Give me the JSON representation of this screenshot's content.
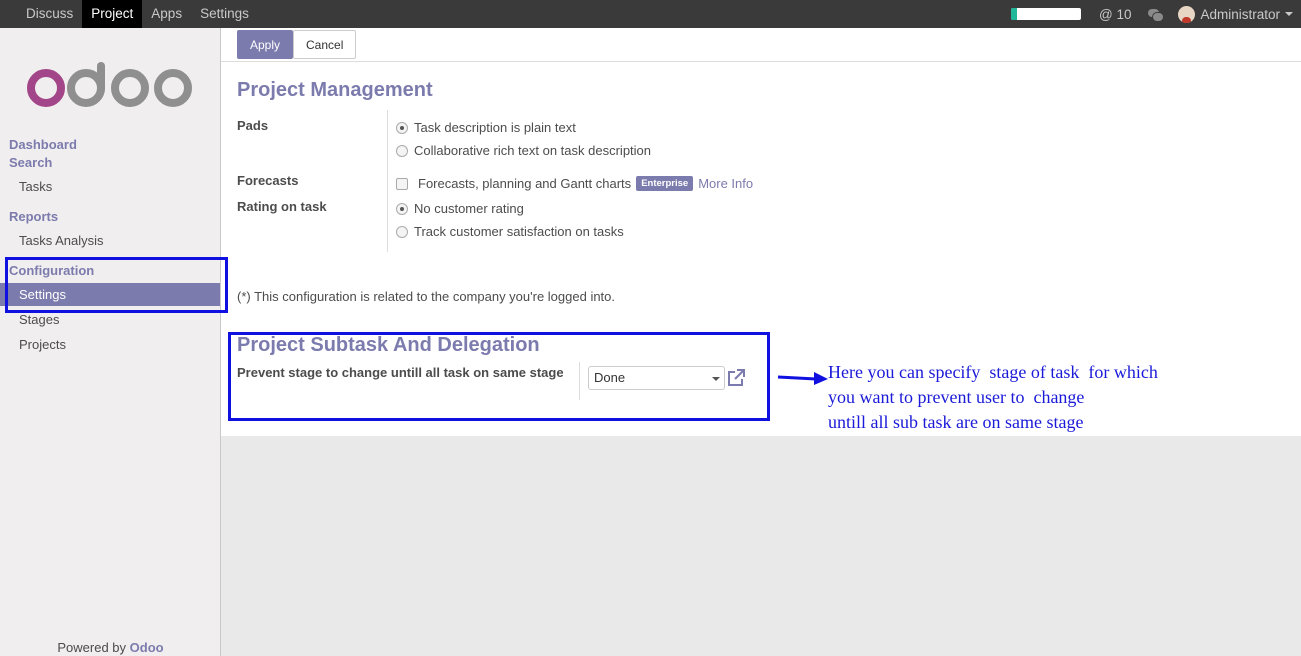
{
  "topbar": {
    "menu": [
      "Discuss",
      "Project",
      "Apps",
      "Settings"
    ],
    "active_menu": "Project",
    "progress_fraction": 0.08,
    "mentions": "@ 10",
    "user": "Administrator"
  },
  "sidebar": {
    "logo_text": "odoo",
    "sections": {
      "dashboard": "Dashboard",
      "search": "Search",
      "tasks": "Tasks",
      "reports": "Reports",
      "tasks_analysis": "Tasks Analysis",
      "configuration": "Configuration",
      "settings": "Settings",
      "stages": "Stages",
      "projects": "Projects"
    },
    "powered_by": "Powered by",
    "brand": "Odoo"
  },
  "control_panel": {
    "apply": "Apply",
    "cancel": "Cancel"
  },
  "form": {
    "title": "Project Management",
    "pads_label": "Pads",
    "pads_option_plain": "Task description is plain text",
    "pads_option_rich": "Collaborative rich text on task description",
    "forecasts_label": "Forecasts",
    "forecasts_option": "Forecasts, planning and Gantt charts",
    "enterprise_badge": "Enterprise",
    "more_info": "More Info",
    "rating_label": "Rating on task",
    "rating_none": "No customer rating",
    "rating_track": "Track customer satisfaction on tasks",
    "company_note": "(*) This configuration is related to the company you're logged into.",
    "subtask_title": "Project Subtask And Delegation",
    "prevent_label": "Prevent stage to change untill all task on same stage",
    "prevent_value": "Done"
  },
  "annotation": {
    "text": "Here you can specify  stage of task  for which\nyou want to prevent user to  change\nuntill all sub task are on same stage",
    "color": "#1a1ad8"
  },
  "colors": {
    "brand": "#7c7bad",
    "highlight": "#1010e0"
  }
}
